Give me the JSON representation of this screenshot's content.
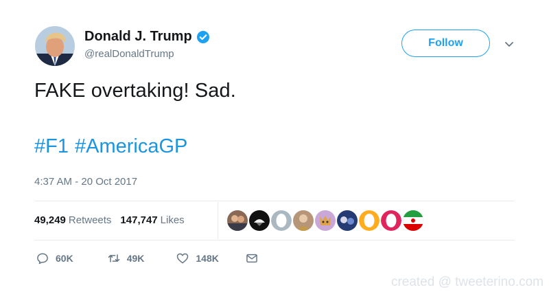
{
  "user": {
    "display_name": "Donald J. Trump",
    "handle": "@realDonaldTrump"
  },
  "follow_label": "Follow",
  "tweet": {
    "text": "FAKE overtaking! Sad.",
    "hashtags": [
      "#F1",
      "#AmericaGP"
    ],
    "timestamp": "4:37 AM - 20 Oct 2017"
  },
  "stats": {
    "retweets_count": "49,249",
    "retweets_label": "Retweets",
    "likes_count": "147,747",
    "likes_label": "Likes"
  },
  "actions": {
    "reply_count": "60K",
    "retweet_count": "49K",
    "like_count": "148K"
  },
  "watermark": "created @ tweeterino.com",
  "colors": {
    "accent": "#1da1f2",
    "link": "#1b95e0",
    "secondary_text": "#657786"
  }
}
